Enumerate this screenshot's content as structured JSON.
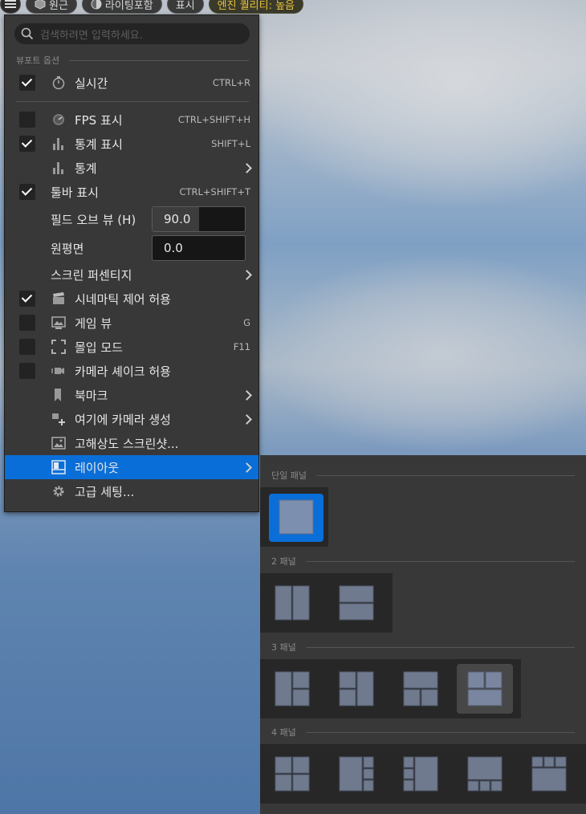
{
  "toolbar": {
    "perspective_label": "원근",
    "lighting_label": "라이팅포함",
    "show_label": "표시",
    "quality_label": "엔진 퀄리티: 높음"
  },
  "menu": {
    "search_placeholder": "검색하려면 입력하세요.",
    "section_viewport_options": "뷰포트 옵션",
    "items": [
      {
        "label": "실시간",
        "shortcut": "CTRL+R",
        "checked": true,
        "icon": "stopwatch-icon"
      },
      {
        "label": "FPS 표시",
        "shortcut": "CTRL+SHIFT+H",
        "checked": false,
        "icon": "gauge-icon"
      },
      {
        "label": "통계 표시",
        "shortcut": "SHIFT+L",
        "checked": true,
        "icon": "bar-chart-icon"
      },
      {
        "label": "통계",
        "shortcut": "",
        "icon": "bar-chart-icon"
      },
      {
        "label": "툴바 표시",
        "shortcut": "CTRL+SHIFT+T",
        "checked": true
      },
      {
        "label": "필드 오브 뷰 (H)",
        "value": "90.0"
      },
      {
        "label": "원평면",
        "value": "0.0"
      },
      {
        "label": "스크린 퍼센티지"
      },
      {
        "label": "시네마틱 제어 허용",
        "checked": true,
        "icon": "clapper-icon"
      },
      {
        "label": "게임 뷰",
        "shortcut": "G",
        "checked": false,
        "icon": "game-view-icon"
      },
      {
        "label": "몰입 모드",
        "shortcut": "F11",
        "checked": false,
        "icon": "fullscreen-icon"
      },
      {
        "label": "카메라 셰이크 허용",
        "checked": false,
        "icon": "camera-shake-icon"
      },
      {
        "label": "북마크",
        "icon": "bookmark-icon"
      },
      {
        "label": "여기에 카메라 생성",
        "icon": "camera-add-icon"
      },
      {
        "label": "고해상도 스크린샷...",
        "icon": "screenshot-icon"
      },
      {
        "label": "레이아웃",
        "icon": "layout-icon"
      },
      {
        "label": "고급 세팅...",
        "icon": "gear-icon"
      }
    ]
  },
  "layout_submenu": {
    "sections": [
      "단일 패널",
      "2 패널",
      "3 패널",
      "4 패널"
    ]
  },
  "colors": {
    "accent": "#0a6ed8",
    "menu_bg": "#383838",
    "quality_text": "#e8c23a"
  }
}
